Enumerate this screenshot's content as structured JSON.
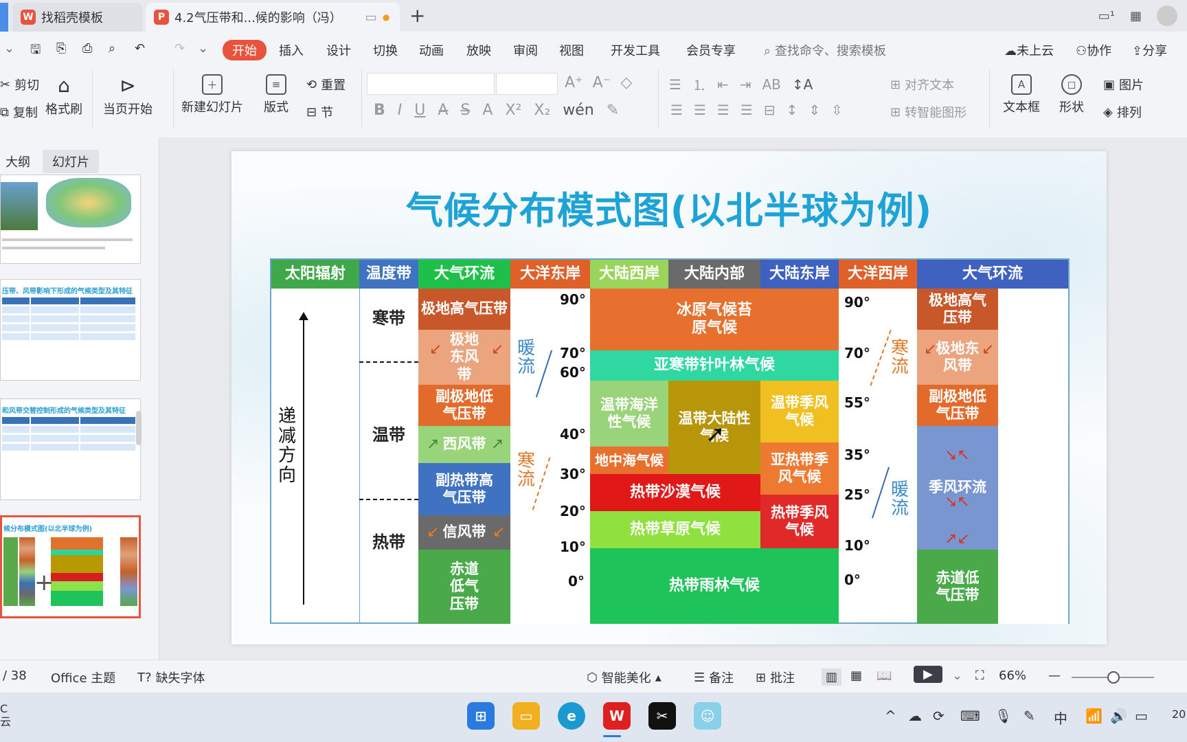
{
  "tabs": [
    {
      "label": "找稻壳模板"
    },
    {
      "label": "4.2气压带和...候的影响（冯）"
    }
  ],
  "window": {
    "new_tab": "+"
  },
  "menu": {
    "items": [
      "开始",
      "插入",
      "设计",
      "切换",
      "动画",
      "放映",
      "审阅",
      "视图",
      "开发工具",
      "会员专享"
    ],
    "search": "查找命令、搜索模板",
    "cloud": "未上云",
    "collab": "协作",
    "share": "分享"
  },
  "toolbar": {
    "cut": "剪切",
    "copy": "复制",
    "format_painter": "格式刷",
    "from_start": "当页开始",
    "new_slide": "新建幻灯片",
    "layout": "版式",
    "reset": "重置",
    "section": "节",
    "align_text": "对齐文本",
    "smart_art": "转智能图形",
    "textbox": "文本框",
    "shape": "形状",
    "picture": "图片",
    "arrange": "排列"
  },
  "sidebar": {
    "tab_outline": "大纲",
    "tab_slides": "幻灯片",
    "thumb2_title": "压带、风带影响下形成的气候类型及其特征",
    "thumb3_title": "和风带交替控制形成的气候类型及其特征",
    "thumb4_title": "候分布模式图(以北半球为例)",
    "add": "+"
  },
  "slide": {
    "title": "气候分布模式图(以北半球为例)",
    "headers": [
      "太阳辐射",
      "温度带",
      "大气环流",
      "大洋东岸",
      "大陆西岸",
      "大陆内部",
      "大陆东岸",
      "大洋西岸",
      "大气环流"
    ],
    "radiation": "递减方向",
    "zones": {
      "cold": "寒带",
      "temperate": "温带",
      "tropical": "热带"
    },
    "belts_left": [
      "极地高气压带",
      "极地东风带",
      "副极地低气压带",
      "西风带",
      "副热带高气压带",
      "信风带",
      "赤道低气压带"
    ],
    "belts_right": [
      "极地高气压带",
      "极地东风带",
      "副极地低气压带",
      "季风环流",
      "赤道低气压带"
    ],
    "lat_left": [
      "90°",
      "70°",
      "60°",
      "40°",
      "30°",
      "20°",
      "10°",
      "0°"
    ],
    "lat_right": [
      "90°",
      "70°",
      "55°",
      "35°",
      "25°",
      "10°",
      "0°"
    ],
    "currents": {
      "warm_left": "暖流",
      "cold_left": "寒流",
      "cold_right": "寒流",
      "warm_right": "暖流"
    },
    "climates": {
      "ice": "冰原气候苔原气候",
      "taiga": "亚寒带针叶林气候",
      "marine": "温带海洋性气候",
      "continental": "温带大陆性气候",
      "temp_monsoon": "温带季风气候",
      "med": "地中海气候",
      "subtrop_monsoon": "亚热带季风气候",
      "desert": "热带沙漠气候",
      "trop_monsoon": "热带季风气候",
      "savanna": "热带草原气候",
      "rainforest": "热带雨林气候"
    }
  },
  "status": {
    "page": "/ 38",
    "theme": "Office 主题",
    "missing_font": "缺失字体",
    "beautify": "智能美化",
    "notes": "备注",
    "comment": "批注",
    "zoom": "66%"
  },
  "taskbar": {
    "ime": "中",
    "weather_c": "C",
    "weather_t": "云",
    "clock": "20"
  },
  "colors": {
    "accent": "#e8533e",
    "title": "#1ea3d6"
  }
}
